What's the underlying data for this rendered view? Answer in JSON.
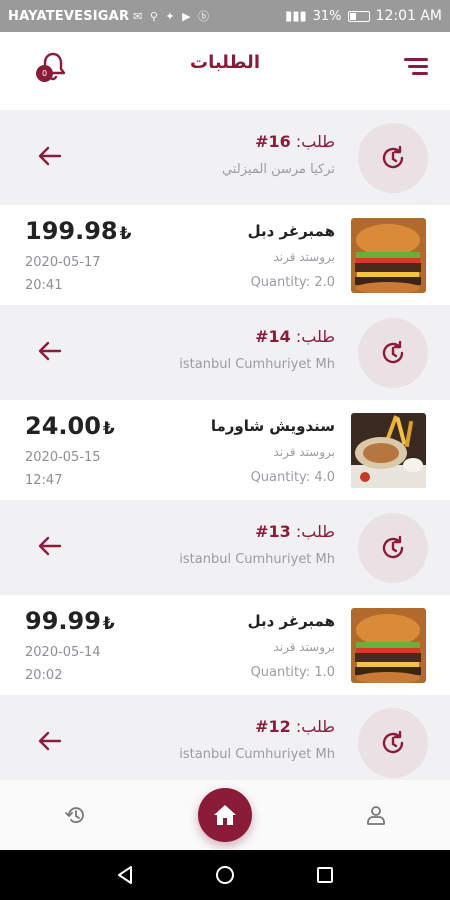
{
  "status_bar": {
    "carrier": "HAYATEVESIGAR",
    "icons": "✉ ⚲ ✦ ▶ ⓑ",
    "battery": "31%",
    "time": "12:01 AM"
  },
  "header": {
    "title": "الطلبات",
    "badge": "0"
  },
  "colors": {
    "brand": "#8a1c3a",
    "muted": "#9b9ba3",
    "section_bg": "#f1f1f3"
  },
  "orders": [
    {
      "label": "طلب:",
      "number": "16#",
      "address": "تركيا مرسن الميزلتي",
      "item": {
        "name": "همبرغر دبل",
        "brand": "بروستد قرند",
        "quantity": "Quantity: 2.0",
        "price": "199.98",
        "currency": "₺",
        "date": "2020-05-17",
        "time": "20:41",
        "image": "burger"
      }
    },
    {
      "label": "طلب:",
      "number": "14#",
      "address": "istanbul Cumhuriyet Mh",
      "item": {
        "name": "سندويش شاورما",
        "brand": "بروستد قرند",
        "quantity": "Quantity: 4.0",
        "price": "24.00",
        "currency": "₺",
        "date": "2020-05-15",
        "time": "12:47",
        "image": "shawarma"
      }
    },
    {
      "label": "طلب:",
      "number": "13#",
      "address": "istanbul Cumhuriyet Mh",
      "item": {
        "name": "همبرغر دبل",
        "brand": "بروستد قرند",
        "quantity": "Quantity: 1.0",
        "price": "99.99",
        "currency": "₺",
        "date": "2020-05-14",
        "time": "20:02",
        "image": "burger"
      }
    },
    {
      "label": "طلب:",
      "number": "12#",
      "address": "istanbul Cumhuriyet Mh"
    }
  ],
  "icons": {
    "bell": "bell-icon",
    "menu": "menu-icon",
    "status": "history-icon",
    "arrow": "arrow-left-icon",
    "nav_history": "history-icon",
    "nav_home": "home-icon",
    "nav_profile": "user-icon"
  }
}
